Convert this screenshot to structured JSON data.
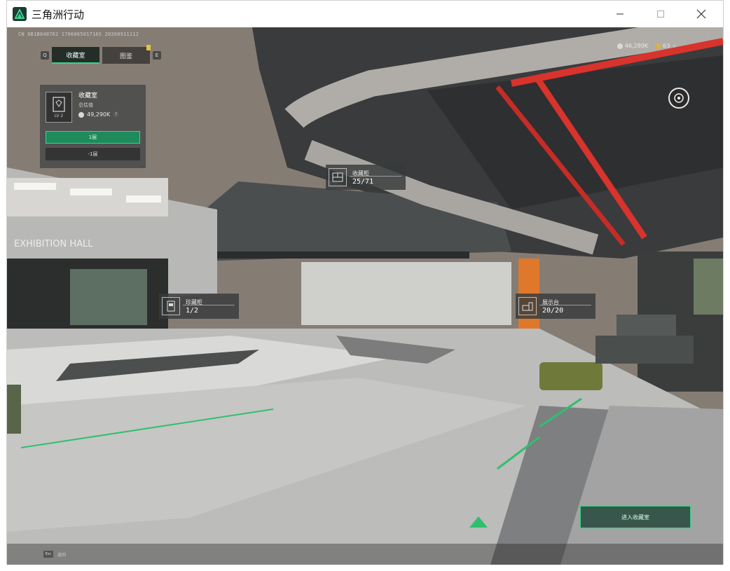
{
  "window": {
    "title": "三角洲行动"
  },
  "hud": {
    "build_info": "CN 8B1B048762 170606501716S 20260911112",
    "tabs": [
      {
        "label": "收藏室",
        "active": true
      },
      {
        "label": "图鉴",
        "active": false
      }
    ],
    "currency": {
      "silver": "46,289K",
      "gold": "63",
      "plus": "+"
    }
  },
  "room_card": {
    "name": "收藏室",
    "sub_label": "总估值",
    "value": "49,290K",
    "level": "LV 2",
    "help": "?",
    "primary_button": "1层",
    "secondary_button": "-1层"
  },
  "scene": {
    "sign_text": "EXHIBITION HALL"
  },
  "labels": [
    {
      "name": "收藏柜",
      "count": "25/71"
    },
    {
      "name": "珍藏柜",
      "count": "1/2"
    },
    {
      "name": "展示台",
      "count": "20/20"
    }
  ],
  "enter_button": "进入收藏室",
  "esc": {
    "key": "Esc",
    "text": "返回"
  },
  "colors": {
    "accent_green": "#2fd187",
    "primary_button_bg": "#1f8a5c",
    "pipe_red": "#d8332c"
  }
}
